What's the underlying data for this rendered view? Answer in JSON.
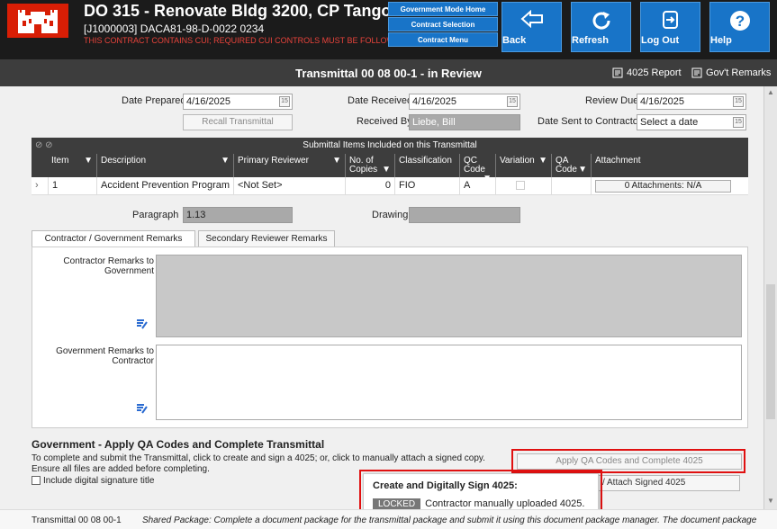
{
  "header": {
    "title": "DO 315 - Renovate Bldg 3200, CP Tango",
    "subtitle": "[J1000003] DACA81-98-D-0022  0234",
    "cui_notice": "THIS CONTRACT CONTAINS CUI; REQUIRED CUI CONTROLS MUST BE FOLLOWED.",
    "nav": [
      "Government Mode Home",
      "Contract Selection",
      "Contract Menu"
    ],
    "buttons": {
      "back": "Back",
      "refresh": "Refresh",
      "logout": "Log Out",
      "help": "Help"
    },
    "brand_color": "#d81e05",
    "button_color": "#1874c8"
  },
  "titlebar": {
    "title": "Transmittal 00 08 00-1 - in Review",
    "report_link": "4025 Report",
    "remarks_link": "Gov't Remarks"
  },
  "form": {
    "date_prepared_label": "Date Prepared",
    "date_prepared": "4/16/2025",
    "date_received_label": "Date Received",
    "date_received": "4/16/2025",
    "review_due_label": "Review Due",
    "review_due": "4/16/2025",
    "recall_button": "Recall Transmittal",
    "received_by_label": "Received By",
    "received_by": "Liebe, Bill",
    "date_sent_label": "Date Sent to Contractor",
    "date_sent_placeholder": "Select a date",
    "calendar_glyph": "15"
  },
  "grid": {
    "title": "Submittal Items Included on this Transmittal",
    "columns": [
      "Item",
      "Description",
      "Primary Reviewer",
      "No. of Copies",
      "Classification",
      "QC Code",
      "Variation",
      "QA Code",
      "Attachment"
    ],
    "row": {
      "item": "1",
      "description": "Accident Prevention Program",
      "reviewer": "<Not Set>",
      "copies": "0",
      "classification": "FIO",
      "qc_code": "A",
      "qa_code": "",
      "attachment": "0 Attachments: N/A"
    }
  },
  "paragraph_label": "Paragraph",
  "paragraph_value": "1.13",
  "drawing_label": "Drawing",
  "tabs": [
    "Contractor / Government Remarks",
    "Secondary Reviewer Remarks"
  ],
  "remarks": {
    "contractor_label": "Contractor Remarks to Government",
    "government_label": "Government Remarks to Contractor"
  },
  "qa_section": {
    "title": "Government - Apply QA Codes and Complete Transmittal",
    "instructions_1": "To complete and submit the Transmittal, click to create and sign a 4025; or, click to manually attach a signed copy.",
    "instructions_2": "Ensure all files are added before completing.",
    "checkbox_label": "Include digital signature title",
    "apply_button": "Apply QA Codes and Complete 4025",
    "attach_button": "/ Attach Signed 4025"
  },
  "popup": {
    "title": "Create and Digitally Sign 4025:",
    "badge": "LOCKED",
    "message": "Contractor manually uploaded 4025."
  },
  "footer": {
    "left": "Transmittal 00 08 00-1",
    "text": "Shared Package: Complete a document package for the transmittal package and submit it using this document package manager. The document package"
  }
}
